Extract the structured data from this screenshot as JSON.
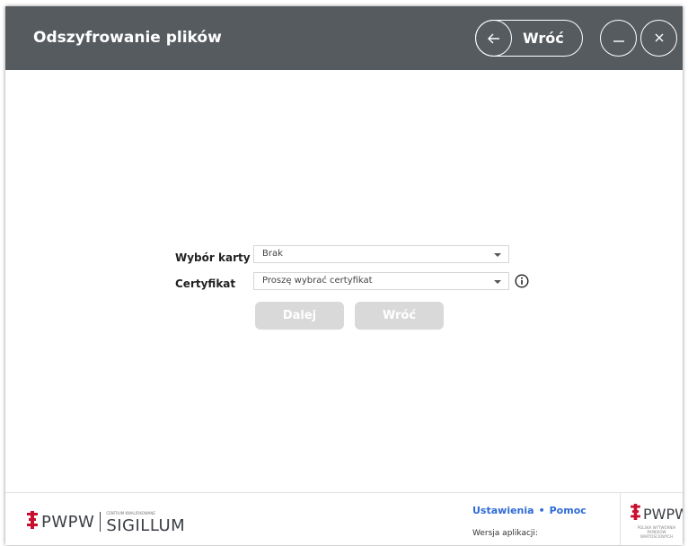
{
  "header": {
    "title": "Odszyfrowanie plików",
    "back_label": "Wróć"
  },
  "form": {
    "card_label": "Wybór karty",
    "card_value": "Brak",
    "cert_label": "Certyfikat",
    "cert_value": "Proszę wybrać certyfikat",
    "next_label": "Dalej",
    "back_label": "Wróć"
  },
  "footer": {
    "logo_left_text": "PWPW",
    "sigillum_small": "CENTRUM KWALIFIKOWANE",
    "sigillum_text": "SIGILLUM",
    "settings_label": "Ustawienia",
    "help_label": "Pomoc",
    "version_label": "Wersja aplikacji:",
    "logo_right_text": "PWPW",
    "logo_right_sub": "POLSKA WYTWÓRNIA PAPIERÓW WARTOŚCIOWYCH"
  },
  "colors": {
    "header_bg": "#565b60",
    "link": "#2f6bd6",
    "disabled_btn": "#d9d9d9",
    "logo_red": "#c8102e"
  }
}
